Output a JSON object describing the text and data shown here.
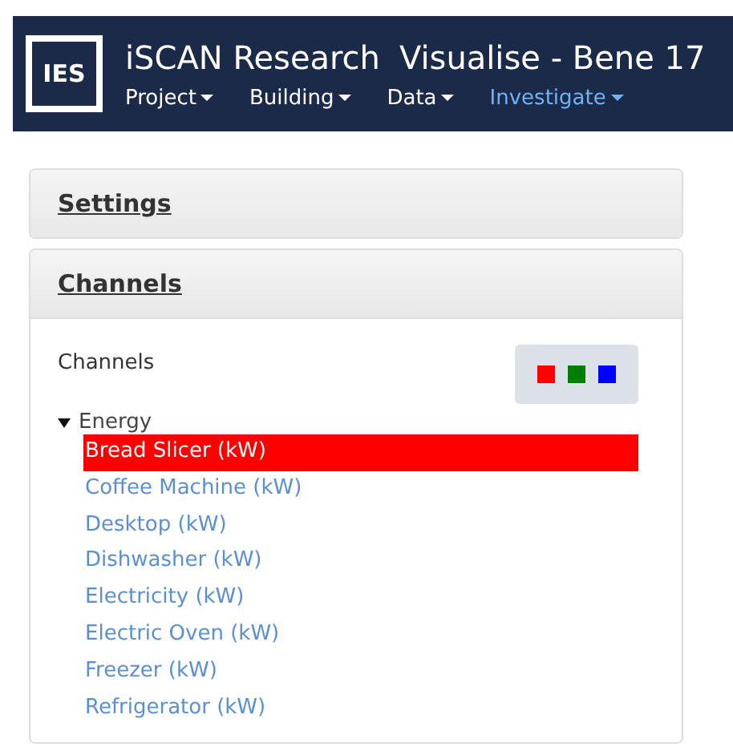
{
  "navbar": {
    "logo": "IES",
    "title": "iSCAN Research",
    "subtitle": "Visualise - Bene 17",
    "menus": [
      {
        "label": "Project",
        "selected": false
      },
      {
        "label": "Building",
        "selected": false
      },
      {
        "label": "Data",
        "selected": false
      },
      {
        "label": "Investigate",
        "selected": true
      }
    ]
  },
  "panels": [
    {
      "title": "Settings",
      "expanded": false
    },
    {
      "title": "Channels",
      "expanded": true
    }
  ],
  "channels": {
    "label": "Channels",
    "swatches": [
      {
        "color": "#ff0000"
      },
      {
        "color": "#008000"
      },
      {
        "color": "#0000ff"
      }
    ],
    "tree": {
      "label": "Energy",
      "expanded": true,
      "children": [
        {
          "label": "Bread Slicer (kW)",
          "selected": true
        },
        {
          "label": "Coffee Machine (kW)",
          "selected": false
        },
        {
          "label": "Desktop (kW)",
          "selected": false
        },
        {
          "label": "Dishwasher (kW)",
          "selected": false
        },
        {
          "label": "Electricity (kW)",
          "selected": false
        },
        {
          "label": "Electric Oven (kW)",
          "selected": false
        },
        {
          "label": "Freezer (kW)",
          "selected": false
        },
        {
          "label": "Refrigerator (kW)",
          "selected": false
        }
      ]
    }
  }
}
